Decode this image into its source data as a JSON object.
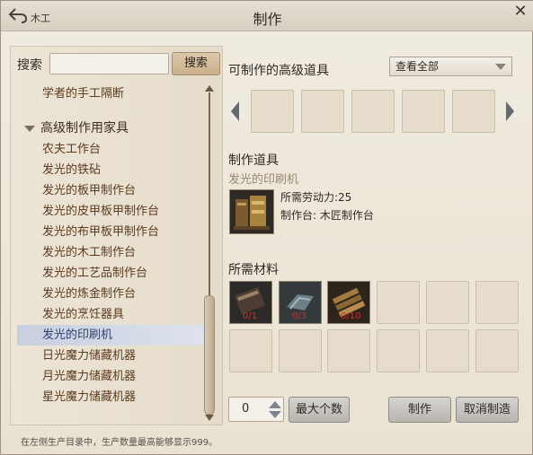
{
  "window": {
    "breadcrumb": "木工",
    "title": "制作"
  },
  "search": {
    "label": "搜索",
    "value": "",
    "button": "搜索"
  },
  "list": {
    "top_item": "学者的手工隔断",
    "category": "高级制作用家具",
    "items": [
      "农夫工作台",
      "发光的铁砧",
      "发光的板甲制作台",
      "发光的皮甲板甲制作台",
      "发光的布甲板甲制作台",
      "发光的木工制作台",
      "发光的工艺品制作台",
      "发光的炼金制作台",
      "发光的烹饪器具",
      "发光的印刷机",
      "日光魔力储藏机器",
      "月光魔力储藏机器",
      "星光魔力储藏机器"
    ],
    "selected_index": 9
  },
  "advanced": {
    "title": "可制作的高级道具",
    "filter": "查看全部"
  },
  "craft": {
    "title": "制作道具",
    "item_name": "发光的印刷机",
    "labor": "所需劳动力:25",
    "station": "制作台: 木匠制作台"
  },
  "materials": {
    "title": "所需材料",
    "counts": [
      "0/1",
      "0/3",
      "0/10"
    ]
  },
  "controls": {
    "quantity": "0",
    "max_button": "最大个数",
    "craft_button": "制作",
    "cancel_button": "取消制造"
  },
  "footer": "在左侧生产目录中，生产数量最高能够显示999。",
  "colors": {
    "selected_row": "#c8cfe0",
    "material_count": "#c9322a",
    "list_text": "#5c3b1e"
  }
}
